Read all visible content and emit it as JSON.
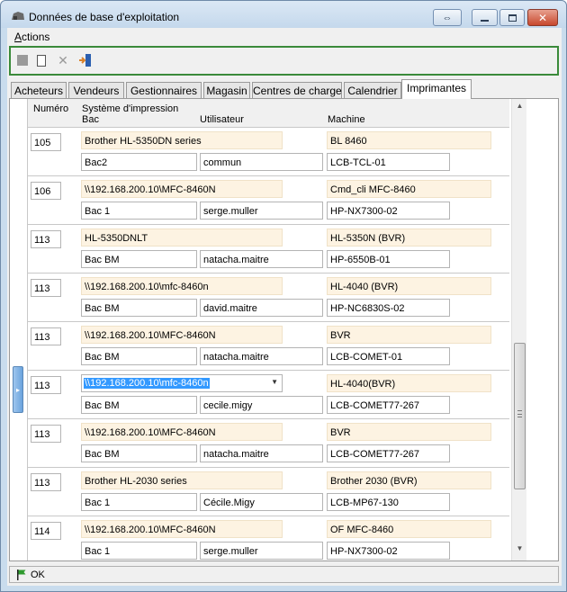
{
  "window": {
    "title": "Données de base d'exploitation"
  },
  "menu": {
    "actions_first": "A",
    "actions_rest": "ctions"
  },
  "tabs": [
    "Acheteurs",
    "Vendeurs",
    "Gestionnaires",
    "Magasin",
    "Centres de charge",
    "Calendrier",
    "Imprimantes"
  ],
  "active_tab": 6,
  "columns": {
    "numero": "Numéro",
    "systeme": "Système d'impression",
    "bac": "Bac",
    "utilisateur": "Utilisateur",
    "machine": "Machine"
  },
  "rows": [
    {
      "num": "105",
      "sys": "Brother HL-5350DN series",
      "machine": "BL 8460",
      "bac": "Bac2",
      "user": "commun",
      "host": "LCB-TCL-01"
    },
    {
      "num": "106",
      "sys": "\\\\192.168.200.10\\MFC-8460N",
      "machine": "Cmd_cli MFC-8460",
      "bac": "Bac 1",
      "user": "serge.muller",
      "host": "HP-NX7300-02"
    },
    {
      "num": "113",
      "sys": "HL-5350DNLT",
      "machine": "HL-5350N (BVR)",
      "bac": "Bac BM",
      "user": "natacha.maitre",
      "host": "HP-6550B-01"
    },
    {
      "num": "113",
      "sys": "\\\\192.168.200.10\\mfc-8460n",
      "machine": "HL-4040 (BVR)",
      "bac": "Bac BM",
      "user": "david.maitre",
      "host": "HP-NC6830S-02"
    },
    {
      "num": "113",
      "sys": "\\\\192.168.200.10\\MFC-8460N",
      "machine": "BVR",
      "bac": "Bac BM",
      "user": "natacha.maitre",
      "host": "LCB-COMET-01"
    },
    {
      "num": "113",
      "sys": "\\\\192.168.200.10\\mfc-8460n",
      "machine": "HL-4040(BVR)",
      "bac": "Bac BM",
      "user": "cecile.migy",
      "host": "LCB-COMET77-267"
    },
    {
      "num": "113",
      "sys": "\\\\192.168.200.10\\MFC-8460N",
      "machine": "BVR",
      "bac": "Bac BM",
      "user": "natacha.maitre",
      "host": "LCB-COMET77-267"
    },
    {
      "num": "113",
      "sys": "Brother HL-2030 series",
      "machine": "Brother 2030 (BVR)",
      "bac": "Bac 1",
      "user": "Cécile.Migy",
      "host": "LCB-MP67-130"
    },
    {
      "num": "114",
      "sys": "\\\\192.168.200.10\\MFC-8460N",
      "machine": "OF MFC-8460",
      "bac": "Bac 1",
      "user": "serge.muller",
      "host": "HP-NX7300-02"
    }
  ],
  "selected_row": 5,
  "status": {
    "text": "OK"
  },
  "colors": {
    "accent": "#3a8a3a",
    "selection": "#3399ff",
    "field_tan": "#fdf3e2"
  }
}
